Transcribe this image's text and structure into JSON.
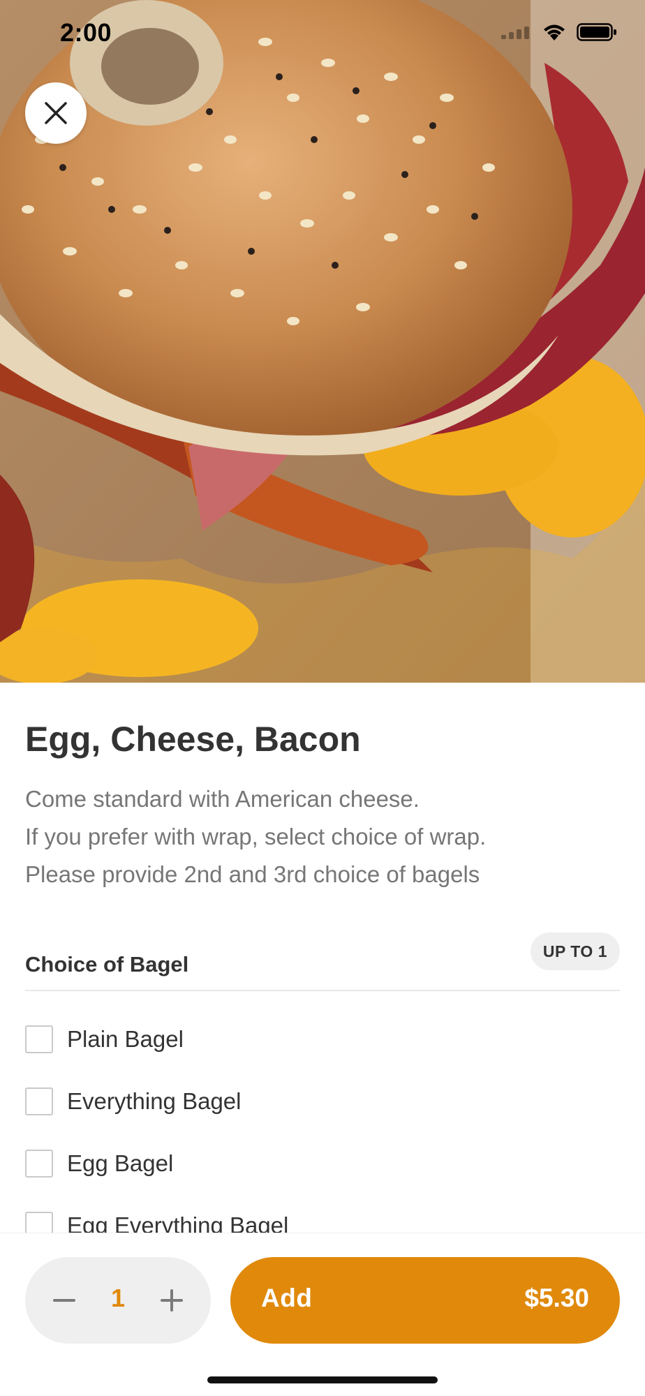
{
  "status_bar": {
    "time": "2:00",
    "icons": [
      "signal-icon",
      "wifi-icon",
      "battery-icon"
    ]
  },
  "hero": {
    "image": "bagel-sandwich-photo",
    "close_icon": "close-icon"
  },
  "item": {
    "title": "Egg, Cheese, Bacon",
    "description": [
      "Come standard with American cheese.",
      "If you prefer with wrap, select choice of wrap.",
      "Please provide 2nd and 3rd choice of bagels"
    ]
  },
  "section": {
    "title": "Choice of Bagel",
    "badge": "UP TO 1",
    "options": [
      {
        "label": "Plain Bagel",
        "checked": false
      },
      {
        "label": "Everything Bagel",
        "checked": false
      },
      {
        "label": "Egg Bagel",
        "checked": false
      },
      {
        "label": "Egg Everything Bagel",
        "checked": false
      }
    ]
  },
  "bottom_bar": {
    "quantity": "1",
    "minus_icon": "minus-icon",
    "plus_icon": "plus-icon",
    "add_label": "Add",
    "price": "$5.30"
  },
  "colors": {
    "accent": "#e0890b",
    "text_primary": "#333333",
    "text_secondary": "#767676",
    "stepper_bg": "#efefef"
  }
}
